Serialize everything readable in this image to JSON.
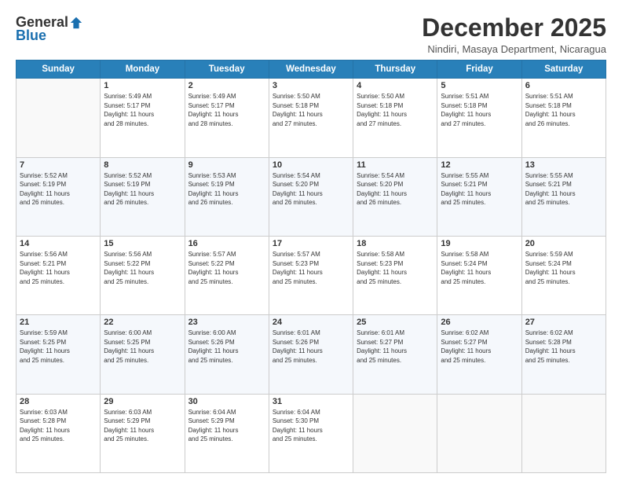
{
  "header": {
    "logo_general": "General",
    "logo_blue": "Blue",
    "month_year": "December 2025",
    "location": "Nindiri, Masaya Department, Nicaragua"
  },
  "days_of_week": [
    "Sunday",
    "Monday",
    "Tuesday",
    "Wednesday",
    "Thursday",
    "Friday",
    "Saturday"
  ],
  "weeks": [
    [
      {
        "day": "",
        "info": ""
      },
      {
        "day": "1",
        "info": "Sunrise: 5:49 AM\nSunset: 5:17 PM\nDaylight: 11 hours\nand 28 minutes."
      },
      {
        "day": "2",
        "info": "Sunrise: 5:49 AM\nSunset: 5:17 PM\nDaylight: 11 hours\nand 28 minutes."
      },
      {
        "day": "3",
        "info": "Sunrise: 5:50 AM\nSunset: 5:18 PM\nDaylight: 11 hours\nand 27 minutes."
      },
      {
        "day": "4",
        "info": "Sunrise: 5:50 AM\nSunset: 5:18 PM\nDaylight: 11 hours\nand 27 minutes."
      },
      {
        "day": "5",
        "info": "Sunrise: 5:51 AM\nSunset: 5:18 PM\nDaylight: 11 hours\nand 27 minutes."
      },
      {
        "day": "6",
        "info": "Sunrise: 5:51 AM\nSunset: 5:18 PM\nDaylight: 11 hours\nand 26 minutes."
      }
    ],
    [
      {
        "day": "7",
        "info": "Sunrise: 5:52 AM\nSunset: 5:19 PM\nDaylight: 11 hours\nand 26 minutes."
      },
      {
        "day": "8",
        "info": "Sunrise: 5:52 AM\nSunset: 5:19 PM\nDaylight: 11 hours\nand 26 minutes."
      },
      {
        "day": "9",
        "info": "Sunrise: 5:53 AM\nSunset: 5:19 PM\nDaylight: 11 hours\nand 26 minutes."
      },
      {
        "day": "10",
        "info": "Sunrise: 5:54 AM\nSunset: 5:20 PM\nDaylight: 11 hours\nand 26 minutes."
      },
      {
        "day": "11",
        "info": "Sunrise: 5:54 AM\nSunset: 5:20 PM\nDaylight: 11 hours\nand 26 minutes."
      },
      {
        "day": "12",
        "info": "Sunrise: 5:55 AM\nSunset: 5:21 PM\nDaylight: 11 hours\nand 25 minutes."
      },
      {
        "day": "13",
        "info": "Sunrise: 5:55 AM\nSunset: 5:21 PM\nDaylight: 11 hours\nand 25 minutes."
      }
    ],
    [
      {
        "day": "14",
        "info": "Sunrise: 5:56 AM\nSunset: 5:21 PM\nDaylight: 11 hours\nand 25 minutes."
      },
      {
        "day": "15",
        "info": "Sunrise: 5:56 AM\nSunset: 5:22 PM\nDaylight: 11 hours\nand 25 minutes."
      },
      {
        "day": "16",
        "info": "Sunrise: 5:57 AM\nSunset: 5:22 PM\nDaylight: 11 hours\nand 25 minutes."
      },
      {
        "day": "17",
        "info": "Sunrise: 5:57 AM\nSunset: 5:23 PM\nDaylight: 11 hours\nand 25 minutes."
      },
      {
        "day": "18",
        "info": "Sunrise: 5:58 AM\nSunset: 5:23 PM\nDaylight: 11 hours\nand 25 minutes."
      },
      {
        "day": "19",
        "info": "Sunrise: 5:58 AM\nSunset: 5:24 PM\nDaylight: 11 hours\nand 25 minutes."
      },
      {
        "day": "20",
        "info": "Sunrise: 5:59 AM\nSunset: 5:24 PM\nDaylight: 11 hours\nand 25 minutes."
      }
    ],
    [
      {
        "day": "21",
        "info": "Sunrise: 5:59 AM\nSunset: 5:25 PM\nDaylight: 11 hours\nand 25 minutes."
      },
      {
        "day": "22",
        "info": "Sunrise: 6:00 AM\nSunset: 5:25 PM\nDaylight: 11 hours\nand 25 minutes."
      },
      {
        "day": "23",
        "info": "Sunrise: 6:00 AM\nSunset: 5:26 PM\nDaylight: 11 hours\nand 25 minutes."
      },
      {
        "day": "24",
        "info": "Sunrise: 6:01 AM\nSunset: 5:26 PM\nDaylight: 11 hours\nand 25 minutes."
      },
      {
        "day": "25",
        "info": "Sunrise: 6:01 AM\nSunset: 5:27 PM\nDaylight: 11 hours\nand 25 minutes."
      },
      {
        "day": "26",
        "info": "Sunrise: 6:02 AM\nSunset: 5:27 PM\nDaylight: 11 hours\nand 25 minutes."
      },
      {
        "day": "27",
        "info": "Sunrise: 6:02 AM\nSunset: 5:28 PM\nDaylight: 11 hours\nand 25 minutes."
      }
    ],
    [
      {
        "day": "28",
        "info": "Sunrise: 6:03 AM\nSunset: 5:28 PM\nDaylight: 11 hours\nand 25 minutes."
      },
      {
        "day": "29",
        "info": "Sunrise: 6:03 AM\nSunset: 5:29 PM\nDaylight: 11 hours\nand 25 minutes."
      },
      {
        "day": "30",
        "info": "Sunrise: 6:04 AM\nSunset: 5:29 PM\nDaylight: 11 hours\nand 25 minutes."
      },
      {
        "day": "31",
        "info": "Sunrise: 6:04 AM\nSunset: 5:30 PM\nDaylight: 11 hours\nand 25 minutes."
      },
      {
        "day": "",
        "info": ""
      },
      {
        "day": "",
        "info": ""
      },
      {
        "day": "",
        "info": ""
      }
    ]
  ]
}
